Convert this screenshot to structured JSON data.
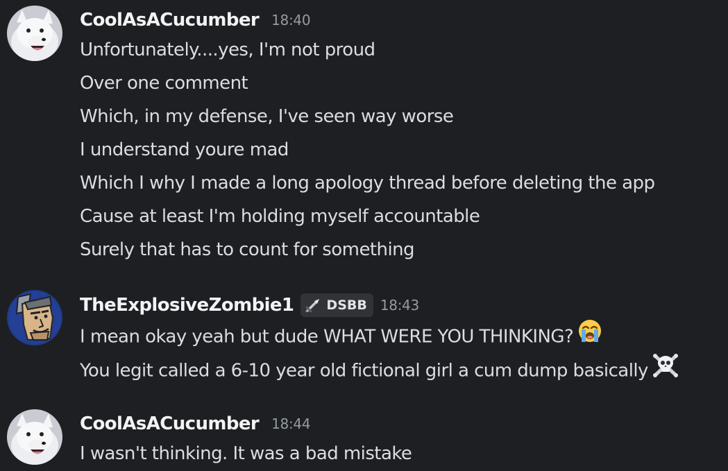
{
  "messages": [
    {
      "author": "CoolAsACucumber",
      "timestamp": "18:40",
      "avatar_icon": "arctic-fox-avatar",
      "lines": [
        "Unfortunately....yes, I'm not proud",
        "Over one comment",
        "Which, in my defense, I've seen way worse",
        "I understand youre mad",
        "Which I why I made a long apology thread before deleting the app",
        "Cause at least I'm holding myself accountable",
        "Surely that has to count for something"
      ]
    },
    {
      "author": "TheExplosiveZombie1",
      "role_tag": "DSBB",
      "role_icon": "sword-icon",
      "timestamp": "18:43",
      "avatar_icon": "cartoon-man-avatar",
      "lines": [
        "I mean okay yeah but dude WHAT WERE YOU THINKING?",
        "You legit called a 6-10 year old fictional girl a cum dump basically"
      ],
      "line_emojis": [
        "loudly-crying-face-emoji",
        "skull-and-crossbones-emoji"
      ]
    },
    {
      "author": "CoolAsACucumber",
      "timestamp": "18:44",
      "avatar_icon": "arctic-fox-avatar",
      "lines": [
        "I wasn't thinking. It was a bad mistake"
      ]
    }
  ],
  "colors": {
    "background": "#1e1f22",
    "username": "#f2f3f5",
    "message_text": "#dbdee1",
    "timestamp": "#949ba4",
    "role_tag_bg": "#313338"
  }
}
